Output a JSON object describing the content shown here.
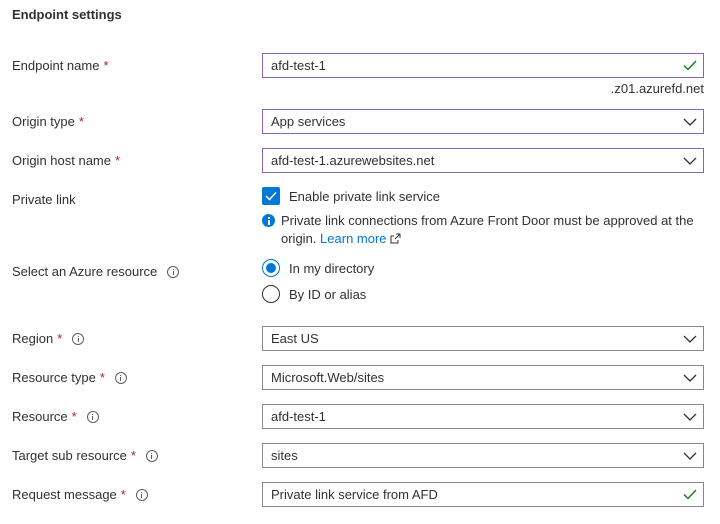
{
  "section": {
    "title": "Endpoint settings"
  },
  "fields": {
    "endpoint_name": {
      "label": "Endpoint name",
      "value": "afd-test-1",
      "suffix": ".z01.azurefd.net"
    },
    "origin_type": {
      "label": "Origin type",
      "value": "App services"
    },
    "origin_host_name": {
      "label": "Origin host name",
      "value": "afd-test-1.azurewebsites.net"
    },
    "private_link": {
      "label": "Private link",
      "checkbox_label": "Enable private link service",
      "checked": true,
      "info_text": "Private link connections from Azure Front Door must be approved at the origin.",
      "learn_more": "Learn more"
    },
    "select_resource": {
      "label": "Select an Azure resource",
      "options": [
        "In my directory",
        "By ID or alias"
      ],
      "selected": "In my directory"
    },
    "region": {
      "label": "Region",
      "value": "East US"
    },
    "resource_type": {
      "label": "Resource type",
      "value": "Microsoft.Web/sites"
    },
    "resource": {
      "label": "Resource",
      "value": "afd-test-1"
    },
    "target_sub_resource": {
      "label": "Target sub resource",
      "value": "sites"
    },
    "request_message": {
      "label": "Request message",
      "value": "Private link service from AFD"
    }
  },
  "required_marker": "*",
  "colors": {
    "accent": "#0078d4",
    "required": "#a4262c",
    "valid": "#107c10",
    "focus_border": "#8764b8"
  }
}
